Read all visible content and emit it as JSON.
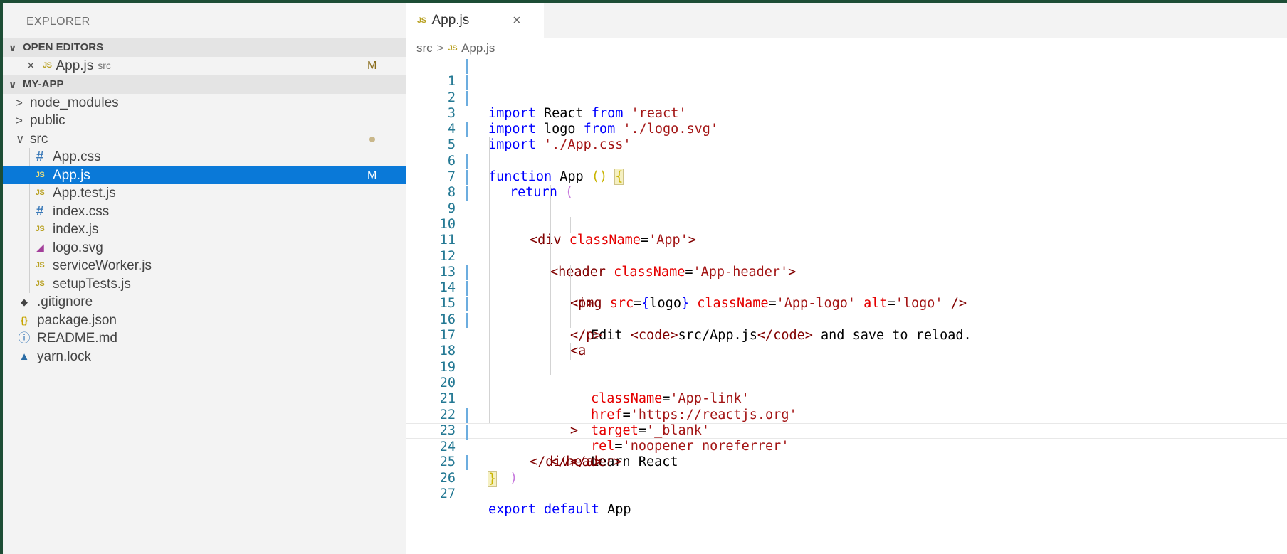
{
  "sidebar": {
    "title": "EXPLORER",
    "open_editors": {
      "label": "OPEN EDITORS",
      "items": [
        {
          "name": "App.js",
          "hint": "src",
          "badge": "M"
        }
      ]
    },
    "project": {
      "label": "MY-APP",
      "items": [
        {
          "label": "node_modules"
        },
        {
          "label": "public"
        },
        {
          "label": "src"
        },
        {
          "label": "App.css"
        },
        {
          "label": "App.js",
          "badge": "M"
        },
        {
          "label": "App.test.js"
        },
        {
          "label": "index.css"
        },
        {
          "label": "index.js"
        },
        {
          "label": "logo.svg"
        },
        {
          "label": "serviceWorker.js"
        },
        {
          "label": "setupTests.js"
        },
        {
          "label": ".gitignore"
        },
        {
          "label": "package.json"
        },
        {
          "label": "README.md"
        },
        {
          "label": "yarn.lock"
        }
      ]
    }
  },
  "editor": {
    "tab": {
      "icon": "JS",
      "label": "App.js",
      "close": "×"
    },
    "breadcrumb": {
      "folder": "src",
      "separator": ">",
      "icon": "JS",
      "file": "App.js"
    },
    "line_numbers": [
      "1",
      "2",
      "3",
      "4",
      "5",
      "6",
      "7",
      "8",
      "9",
      "10",
      "11",
      "12",
      "13",
      "14",
      "15",
      "16",
      "17",
      "18",
      "19",
      "20",
      "21",
      "22",
      "23",
      "24",
      "25",
      "26",
      "27"
    ],
    "code": {
      "l1": [
        "import",
        " React ",
        "from",
        " ",
        "'react'"
      ],
      "l2": [
        "import",
        " logo ",
        "from",
        " ",
        "'./logo.svg'"
      ],
      "l3": [
        "import",
        " ",
        "'./App.css'"
      ],
      "l5": [
        "function",
        " App ",
        "()",
        " ",
        "{"
      ],
      "l6": [
        "return",
        " ",
        "("
      ],
      "l7": [
        "<div",
        " ",
        "className",
        "=",
        "'App'",
        ">"
      ],
      "l8": [
        "<header",
        " ",
        "className",
        "=",
        "'App-header'",
        ">"
      ],
      "l9": [
        "<img",
        " ",
        "src",
        "=",
        "{",
        "logo",
        "}",
        " ",
        "className",
        "=",
        "'App-logo'",
        " ",
        "alt",
        "=",
        "'logo'",
        " ",
        "/>"
      ],
      "l10": [
        "<p>"
      ],
      "l11": [
        "Edit ",
        "<code>",
        "src/App.js",
        "</code>",
        " and save to reload."
      ],
      "l12": [
        "</p>"
      ],
      "l13": [
        "<a"
      ],
      "l14": [
        "className",
        "=",
        "'App-link'"
      ],
      "l15": [
        "href",
        "=",
        "'",
        "https://reactjs.org",
        "'"
      ],
      "l16": [
        "target",
        "=",
        "'_blank'"
      ],
      "l17": [
        "rel",
        "=",
        "'noopener noreferrer'"
      ],
      "l18": [
        ">"
      ],
      "l19": [
        "Learn React"
      ],
      "l20": [
        "</a>"
      ],
      "l21": [
        "</header>"
      ],
      "l22": [
        "</div>"
      ],
      "l23": [
        ")"
      ],
      "l24": [
        "}"
      ],
      "l26": [
        "export",
        " ",
        "default",
        " App"
      ]
    }
  },
  "colors": {
    "accent_selected": "#0a79d8",
    "keyword": "#0000ff",
    "string": "#a31515",
    "tag": "#800000",
    "attribute": "#e50000",
    "line_number": "#237893",
    "frame": "#1d4d35"
  }
}
